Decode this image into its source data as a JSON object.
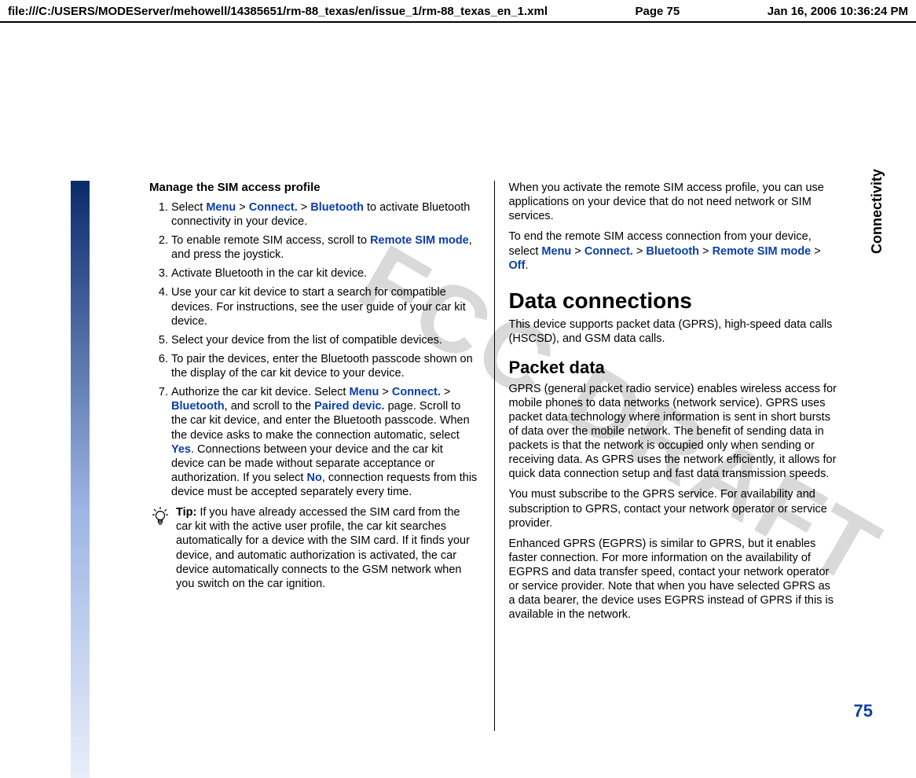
{
  "header": {
    "path": "file:///C:/USERS/MODEServer/mehowell/14385651/rm-88_texas/en/issue_1/rm-88_texas_en_1.xml",
    "page": "Page 75",
    "timestamp": "Jan 16, 2006 10:36:24 PM"
  },
  "watermark": "FCC DRAFT",
  "sidebar_label": "Connectivity",
  "page_number": "75",
  "left": {
    "heading": "Manage the SIM access profile",
    "steps": [
      {
        "pre": "Select ",
        "path": [
          "Menu",
          "Connect.",
          "Bluetooth"
        ],
        "post": " to activate Bluetooth connectivity in your device."
      },
      {
        "pre": "To enable remote SIM access, scroll to ",
        "path": [
          "Remote SIM mode"
        ],
        "post": ", and press the joystick."
      },
      {
        "plain": "Activate Bluetooth in the car kit device."
      },
      {
        "plain": "Use your car kit device to start a search for compatible devices. For instructions, see the user guide of your car kit device."
      },
      {
        "plain": "Select your device from the list of compatible devices."
      },
      {
        "plain": "To pair the devices, enter the Bluetooth passcode shown on the display of the car kit device to your device."
      },
      {
        "pre": "Authorize the car kit device. Select ",
        "path": [
          "Menu",
          "Connect.",
          "Bluetooth"
        ],
        "mid1": ", and scroll to the ",
        "path2": [
          "Paired devic."
        ],
        "mid2": " page. Scroll to the car kit device, and enter the Bluetooth passcode. When the device asks to make the connection automatic, select ",
        "path3": [
          "Yes"
        ],
        "mid3": ". Connections between your device and the car kit device can be made without separate acceptance or authorization. If you select ",
        "path4": [
          "No"
        ],
        "post": ", connection requests from this device must be accepted separately every time."
      }
    ],
    "tip_label": "Tip: ",
    "tip_body": "If you have already accessed the SIM card from the car kit with the active user profile, the car kit searches automatically for a device with the SIM card. If it finds your device, and automatic authorization is activated, the car device automatically connects to the GSM network when you switch on the car ignition."
  },
  "right": {
    "intro": "When you activate the remote SIM access profile, you can use applications on your device that do not need network or SIM services.",
    "end_pre": "To end the remote SIM access connection from your device, select ",
    "end_path": [
      "Menu",
      "Connect.",
      "Bluetooth",
      "Remote SIM mode",
      "Off"
    ],
    "end_post": ".",
    "h1": "Data connections",
    "data_conn_p": "This device supports packet data (GPRS), high-speed data calls (HSCSD), and GSM data calls.",
    "h2": "Packet data",
    "packet_p1": "GPRS (general packet radio service) enables wireless access for mobile phones to data networks (network service). GPRS uses packet data technology where information is sent in short bursts of data over the mobile network. The benefit of sending data in packets is that the network is occupied only when sending or receiving data. As GPRS uses the network efficiently, it allows for quick data connection setup and fast data transmission speeds.",
    "packet_p2": "You must subscribe to the GPRS service. For availability and subscription to GPRS, contact your network operator or service provider.",
    "packet_p3": "Enhanced GPRS (EGPRS) is similar to GPRS, but it enables faster connection. For more information on the availability of EGPRS and data transfer speed, contact your network operator or service provider. Note that when you have selected GPRS as a data bearer, the device uses EGPRS instead of GPRS if this is available in the network."
  }
}
